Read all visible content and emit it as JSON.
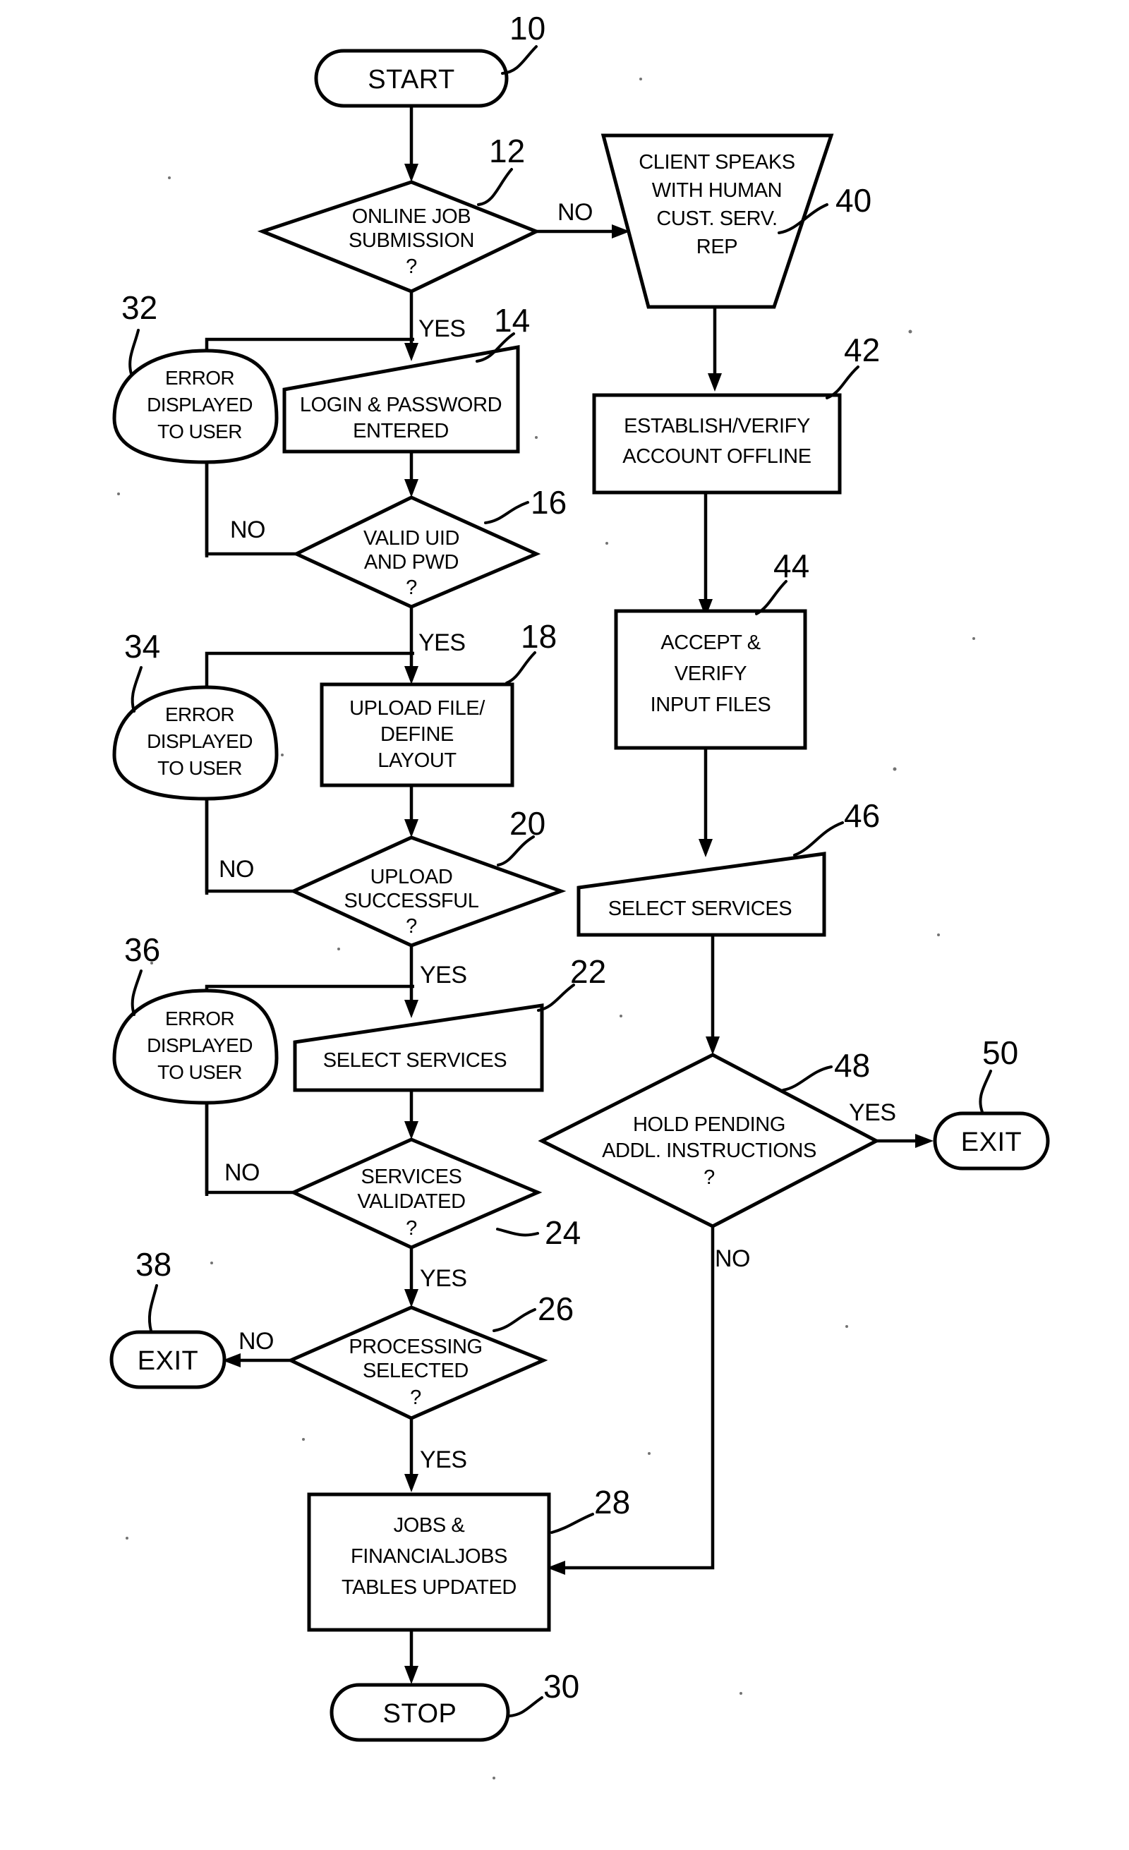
{
  "diagram": {
    "type": "patent-flowchart",
    "background": "#ffffff",
    "ink": "#000000"
  },
  "nodes": {
    "start": {
      "ref": "10",
      "shape": "terminator",
      "label": "START"
    },
    "online_job": {
      "ref": "12",
      "shape": "decision",
      "line1": "ONLINE JOB",
      "line2": "SUBMISSION",
      "line3": "?"
    },
    "client_speaks": {
      "ref": "40",
      "shape": "inverted-trapezoid",
      "line1": "CLIENT SPEAKS",
      "line2": "WITH HUMAN",
      "line3": "CUST. SERV.",
      "line4": "REP"
    },
    "login_password": {
      "ref": "14",
      "shape": "skewed-process",
      "line1": "LOGIN & PASSWORD",
      "line2": "ENTERED"
    },
    "error32": {
      "ref": "32",
      "shape": "ellipse",
      "line1": "ERROR",
      "line2": "DISPLAYED",
      "line3": "TO USER"
    },
    "valid_uid": {
      "ref": "16",
      "shape": "decision",
      "line1": "VALID UID",
      "line2": "AND PWD",
      "line3": "?"
    },
    "upload_file": {
      "ref": "18",
      "shape": "process",
      "line1": "UPLOAD FILE/",
      "line2": "DEFINE",
      "line3": "LAYOUT"
    },
    "error34": {
      "ref": "34",
      "shape": "ellipse",
      "line1": "ERROR",
      "line2": "DISPLAYED",
      "line3": "TO USER"
    },
    "upload_successful": {
      "ref": "20",
      "shape": "decision",
      "line1": "UPLOAD",
      "line2": "SUCCESSFUL",
      "line3": "?"
    },
    "select_services_22": {
      "ref": "22",
      "shape": "skewed-process",
      "line1": "SELECT SERVICES"
    },
    "error36": {
      "ref": "36",
      "shape": "ellipse",
      "line1": "ERROR",
      "line2": "DISPLAYED",
      "line3": "TO USER"
    },
    "services_validated": {
      "ref": "24",
      "shape": "decision",
      "line1": "SERVICES",
      "line2": "VALIDATED",
      "line3": "?"
    },
    "processing_selected": {
      "ref": "26",
      "shape": "decision",
      "line1": "PROCESSING",
      "line2": "SELECTED",
      "line3": "?"
    },
    "exit38": {
      "ref": "38",
      "shape": "terminator",
      "label": "EXIT"
    },
    "jobs_tables": {
      "ref": "28",
      "shape": "process",
      "line1": "JOBS &",
      "line2": "FINANCIALJOBS",
      "line3": "TABLES UPDATED"
    },
    "stop": {
      "ref": "30",
      "shape": "terminator",
      "label": "STOP"
    },
    "establish_verify": {
      "ref": "42",
      "shape": "process",
      "line1": "ESTABLISH/VERIFY",
      "line2": "ACCOUNT OFFLINE"
    },
    "accept_verify": {
      "ref": "44",
      "shape": "process",
      "line1": "ACCEPT &",
      "line2": "VERIFY",
      "line3": "INPUT FILES"
    },
    "select_services_46": {
      "ref": "46",
      "shape": "skewed-process",
      "line1": "SELECT SERVICES"
    },
    "hold_pending": {
      "ref": "48",
      "shape": "decision",
      "line1": "HOLD PENDING",
      "line2": "ADDL. INSTRUCTIONS",
      "line3": "?"
    },
    "exit50": {
      "ref": "50",
      "shape": "terminator",
      "label": "EXIT"
    }
  },
  "edge_labels": {
    "online_job_no": "NO",
    "online_job_yes": "YES",
    "valid_uid_no": "NO",
    "valid_uid_yes": "YES",
    "upload_no": "NO",
    "upload_yes": "YES",
    "services_validated_no": "NO",
    "services_validated_yes": "YES",
    "processing_no": "NO",
    "processing_yes": "YES",
    "hold_pending_yes": "YES",
    "hold_pending_no": "NO"
  },
  "reference_numerals": [
    "10",
    "12",
    "14",
    "16",
    "18",
    "20",
    "22",
    "24",
    "26",
    "28",
    "30",
    "32",
    "34",
    "36",
    "38",
    "40",
    "42",
    "44",
    "46",
    "48",
    "50"
  ]
}
